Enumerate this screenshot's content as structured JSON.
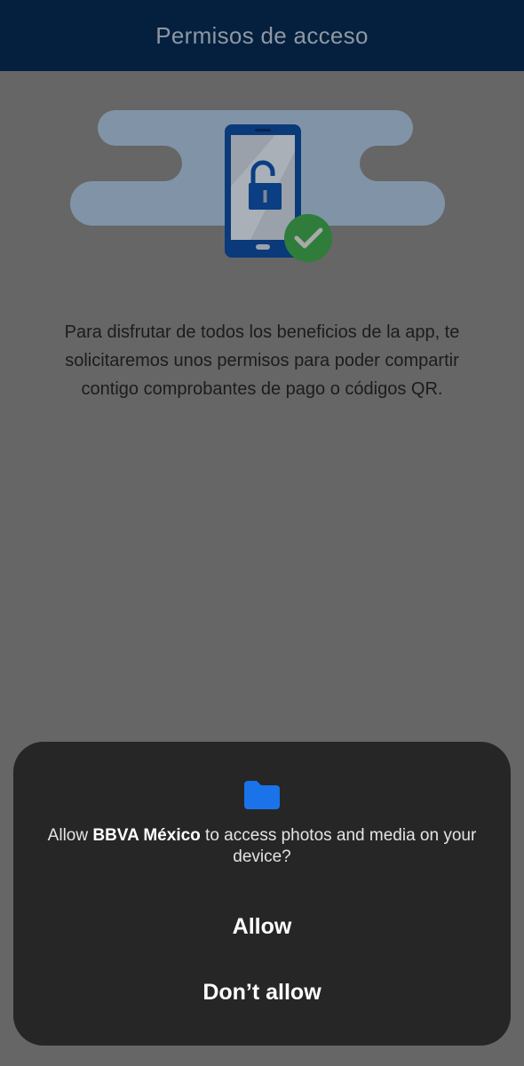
{
  "header": {
    "title": "Permisos de acceso"
  },
  "illustration": {
    "icons": [
      "phone-icon",
      "unlocked-padlock-icon",
      "check-badge-icon"
    ],
    "colors": {
      "band": "#8194a7",
      "phone_body": "#0a3a79",
      "phone_screen": "#9aa1aa",
      "padlock": "#0b3e82",
      "badge": "#2f7c3b"
    }
  },
  "intro": {
    "text": "Para disfrutar de todos los beneficios de la app, te solicitaremos unos permisos para poder compartir contigo comprobantes de pago o códigos QR."
  },
  "dialog": {
    "icon": "folder-icon",
    "icon_color": "#1a73e8",
    "message_prefix": "Allow ",
    "app_name": "BBVA México",
    "message_suffix": " to access photos and media on your device?",
    "allow_label": "Allow",
    "deny_label": "Don’t allow"
  },
  "colors": {
    "header_bg": "#04203e",
    "page_bg": "#666666",
    "dialog_bg": "#262626"
  }
}
